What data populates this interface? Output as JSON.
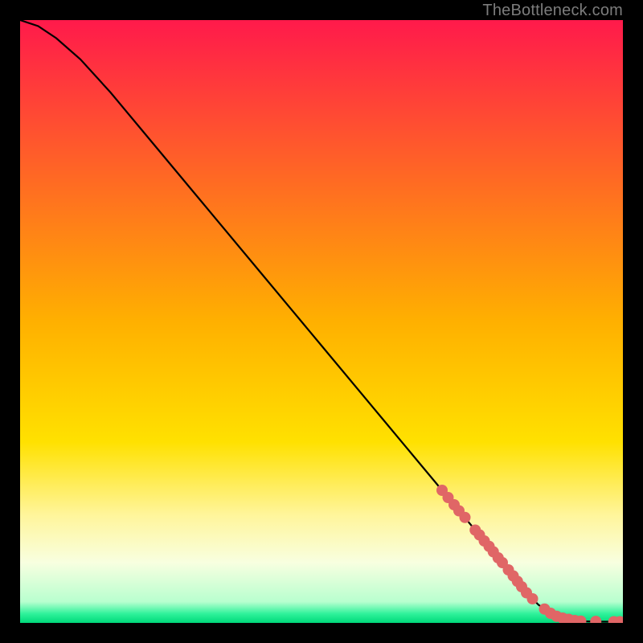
{
  "watermark": "TheBottleneck.com",
  "chart_data": {
    "type": "line",
    "title": "",
    "xlabel": "",
    "ylabel": "",
    "xlim": [
      0,
      100
    ],
    "ylim": [
      0,
      100
    ],
    "background_gradient": {
      "stops": [
        {
          "offset": 0,
          "color": "#ff1a4b"
        },
        {
          "offset": 0.5,
          "color": "#ffb000"
        },
        {
          "offset": 0.7,
          "color": "#ffe100"
        },
        {
          "offset": 0.82,
          "color": "#fff59a"
        },
        {
          "offset": 0.9,
          "color": "#f8ffe0"
        },
        {
          "offset": 0.965,
          "color": "#b8ffcf"
        },
        {
          "offset": 0.985,
          "color": "#2ef29a"
        },
        {
          "offset": 1.0,
          "color": "#00d97a"
        }
      ]
    },
    "series": [
      {
        "name": "bottleneck-curve",
        "color": "#000000",
        "x": [
          0,
          3,
          6,
          10,
          15,
          20,
          30,
          40,
          50,
          60,
          70,
          75,
          80,
          82,
          84,
          86,
          88,
          90,
          92,
          94,
          96,
          98,
          100
        ],
        "y": [
          100,
          99,
          97,
          93.5,
          88,
          82,
          70,
          58,
          46,
          34,
          22,
          16,
          10,
          7.5,
          5,
          3,
          1.6,
          0.8,
          0.4,
          0.25,
          0.2,
          0.2,
          0.2
        ]
      }
    ],
    "markers": {
      "name": "highlighted-points",
      "color": "#e06666",
      "radius": 7,
      "points": [
        {
          "x": 70.0,
          "y": 22.0
        },
        {
          "x": 71.0,
          "y": 20.8
        },
        {
          "x": 72.0,
          "y": 19.6
        },
        {
          "x": 72.8,
          "y": 18.6
        },
        {
          "x": 73.8,
          "y": 17.5
        },
        {
          "x": 75.5,
          "y": 15.4
        },
        {
          "x": 76.2,
          "y": 14.6
        },
        {
          "x": 77.0,
          "y": 13.6
        },
        {
          "x": 77.8,
          "y": 12.7
        },
        {
          "x": 78.5,
          "y": 11.8
        },
        {
          "x": 79.3,
          "y": 10.8
        },
        {
          "x": 80.0,
          "y": 10.0
        },
        {
          "x": 81.0,
          "y": 8.8
        },
        {
          "x": 81.8,
          "y": 7.8
        },
        {
          "x": 82.5,
          "y": 6.9
        },
        {
          "x": 83.2,
          "y": 6.0
        },
        {
          "x": 84.0,
          "y": 5.0
        },
        {
          "x": 85.0,
          "y": 4.0
        },
        {
          "x": 87.0,
          "y": 2.3
        },
        {
          "x": 88.0,
          "y": 1.6
        },
        {
          "x": 89.0,
          "y": 1.1
        },
        {
          "x": 90.0,
          "y": 0.8
        },
        {
          "x": 91.0,
          "y": 0.6
        },
        {
          "x": 92.0,
          "y": 0.4
        },
        {
          "x": 93.0,
          "y": 0.3
        },
        {
          "x": 95.5,
          "y": 0.25
        },
        {
          "x": 98.5,
          "y": 0.2
        },
        {
          "x": 99.5,
          "y": 0.2
        }
      ]
    }
  }
}
